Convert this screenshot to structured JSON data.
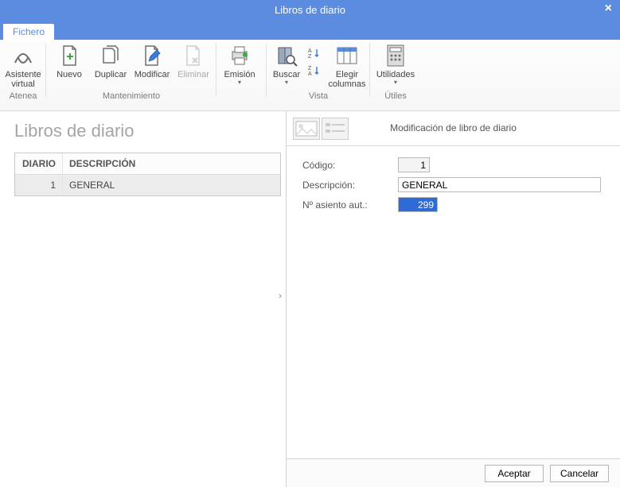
{
  "window": {
    "title": "Libros de diario"
  },
  "tabs": {
    "file": "Fichero"
  },
  "ribbon": {
    "asistente": {
      "line1": "Asistente",
      "line2": "virtual"
    },
    "nuevo": "Nuevo",
    "duplicar": "Duplicar",
    "modificar": "Modificar",
    "eliminar": "Eliminar",
    "emision": "Emisión",
    "buscar": "Buscar",
    "elegir_col": {
      "line1": "Elegir",
      "line2": "columnas"
    },
    "utilidades": "Utilidades",
    "groups": {
      "atenea": "Atenea",
      "mantenimiento": "Mantenimiento",
      "vista": "Vista",
      "utiles": "Útiles"
    }
  },
  "list": {
    "heading": "Libros de diario",
    "columns": {
      "diario": "DIARIO",
      "descripcion": "DESCRIPCIÓN"
    },
    "rows": [
      {
        "id": "1",
        "desc": "GENERAL"
      }
    ]
  },
  "detail": {
    "title": "Modificación de libro de diario",
    "labels": {
      "codigo": "Código:",
      "descripcion": "Descripción:",
      "asiento": "Nº asiento aut.:"
    },
    "values": {
      "codigo": "1",
      "descripcion": "GENERAL",
      "asiento": "299"
    }
  },
  "buttons": {
    "aceptar": "Aceptar",
    "cancelar": "Cancelar"
  }
}
